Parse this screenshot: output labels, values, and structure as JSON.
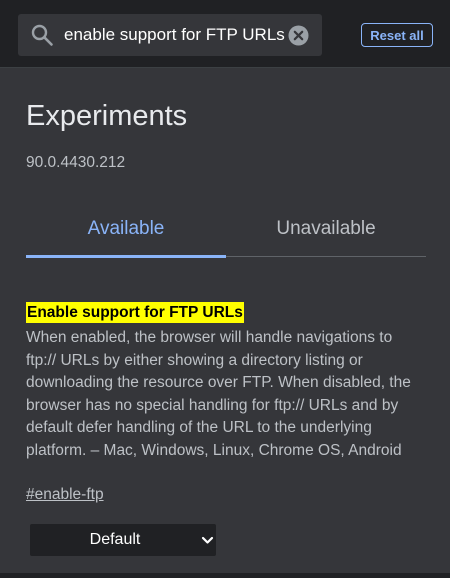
{
  "search": {
    "value": "enable support for FTP URLs",
    "icon": "search-icon",
    "clear_icon": "clear-circle-icon"
  },
  "header": {
    "reset_label": "Reset all"
  },
  "page": {
    "title": "Experiments",
    "version": "90.0.4430.212"
  },
  "tabs": [
    {
      "label": "Available",
      "selected": true
    },
    {
      "label": "Unavailable",
      "selected": false
    }
  ],
  "experiment": {
    "name": "Enable support for FTP URLs",
    "description": "When enabled, the browser will handle navigations to ftp:// URLs by either showing a directory listing or downloading the resource over FTP. When disabled, the browser has no special handling for ftp:// URLs and by default defer handling of the URL to the underlying platform. – Mac, Windows, Linux, Chrome OS, Android",
    "link": "#enable-ftp",
    "select_value": "Default",
    "select_icon": "chevron-down-icon"
  },
  "colors": {
    "background": "#35363a",
    "header_background": "#202124",
    "accent": "#8ab4f8",
    "highlight": "#ffff00",
    "text_secondary": "#bdc1c6"
  }
}
